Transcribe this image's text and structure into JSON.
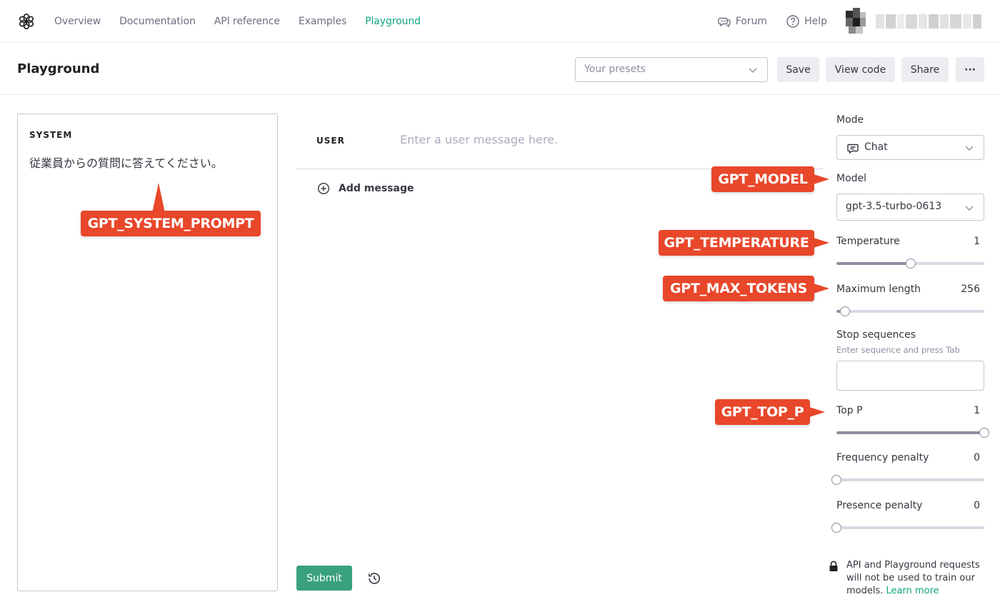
{
  "nav": {
    "links": [
      "Overview",
      "Documentation",
      "API reference",
      "Examples",
      "Playground"
    ],
    "active_index": 4,
    "forum": "Forum",
    "help": "Help"
  },
  "header": {
    "title": "Playground",
    "presets_placeholder": "Your presets",
    "save": "Save",
    "view_code": "View code",
    "share": "Share",
    "more": "···"
  },
  "system": {
    "label": "SYSTEM",
    "prompt": "従業員からの質問に答えてください。"
  },
  "conversation": {
    "user_label": "USER",
    "user_placeholder": "Enter a user message here.",
    "add_message": "Add message",
    "submit": "Submit"
  },
  "settings": {
    "mode_label": "Mode",
    "mode_value": "Chat",
    "model_label": "Model",
    "model_value": "gpt-3.5-turbo-0613",
    "temperature_label": "Temperature",
    "temperature_value": "1",
    "temperature_fraction": 0.5,
    "max_length_label": "Maximum length",
    "max_length_value": "256",
    "max_length_fraction": 0.06,
    "stop_label": "Stop sequences",
    "stop_hint": "Enter sequence and press Tab",
    "top_p_label": "Top P",
    "top_p_value": "1",
    "top_p_fraction": 1.0,
    "frequency_label": "Frequency penalty",
    "frequency_value": "0",
    "frequency_fraction": 0,
    "presence_label": "Presence penalty",
    "presence_value": "0",
    "presence_fraction": 0,
    "privacy_text": "API and Playground requests will not be used to train our models.",
    "learn_more": "Learn more"
  },
  "callouts": {
    "system_prompt": "GPT_SYSTEM_PROMPT",
    "model": "GPT_MODEL",
    "temperature": "GPT_TEMPERATURE",
    "max_tokens": "GPT_MAX_TOKENS",
    "top_p": "GPT_TOP_P"
  },
  "colors": {
    "accent": "#10a37f",
    "submit": "#3aa17e",
    "callout": "#e8472a"
  }
}
